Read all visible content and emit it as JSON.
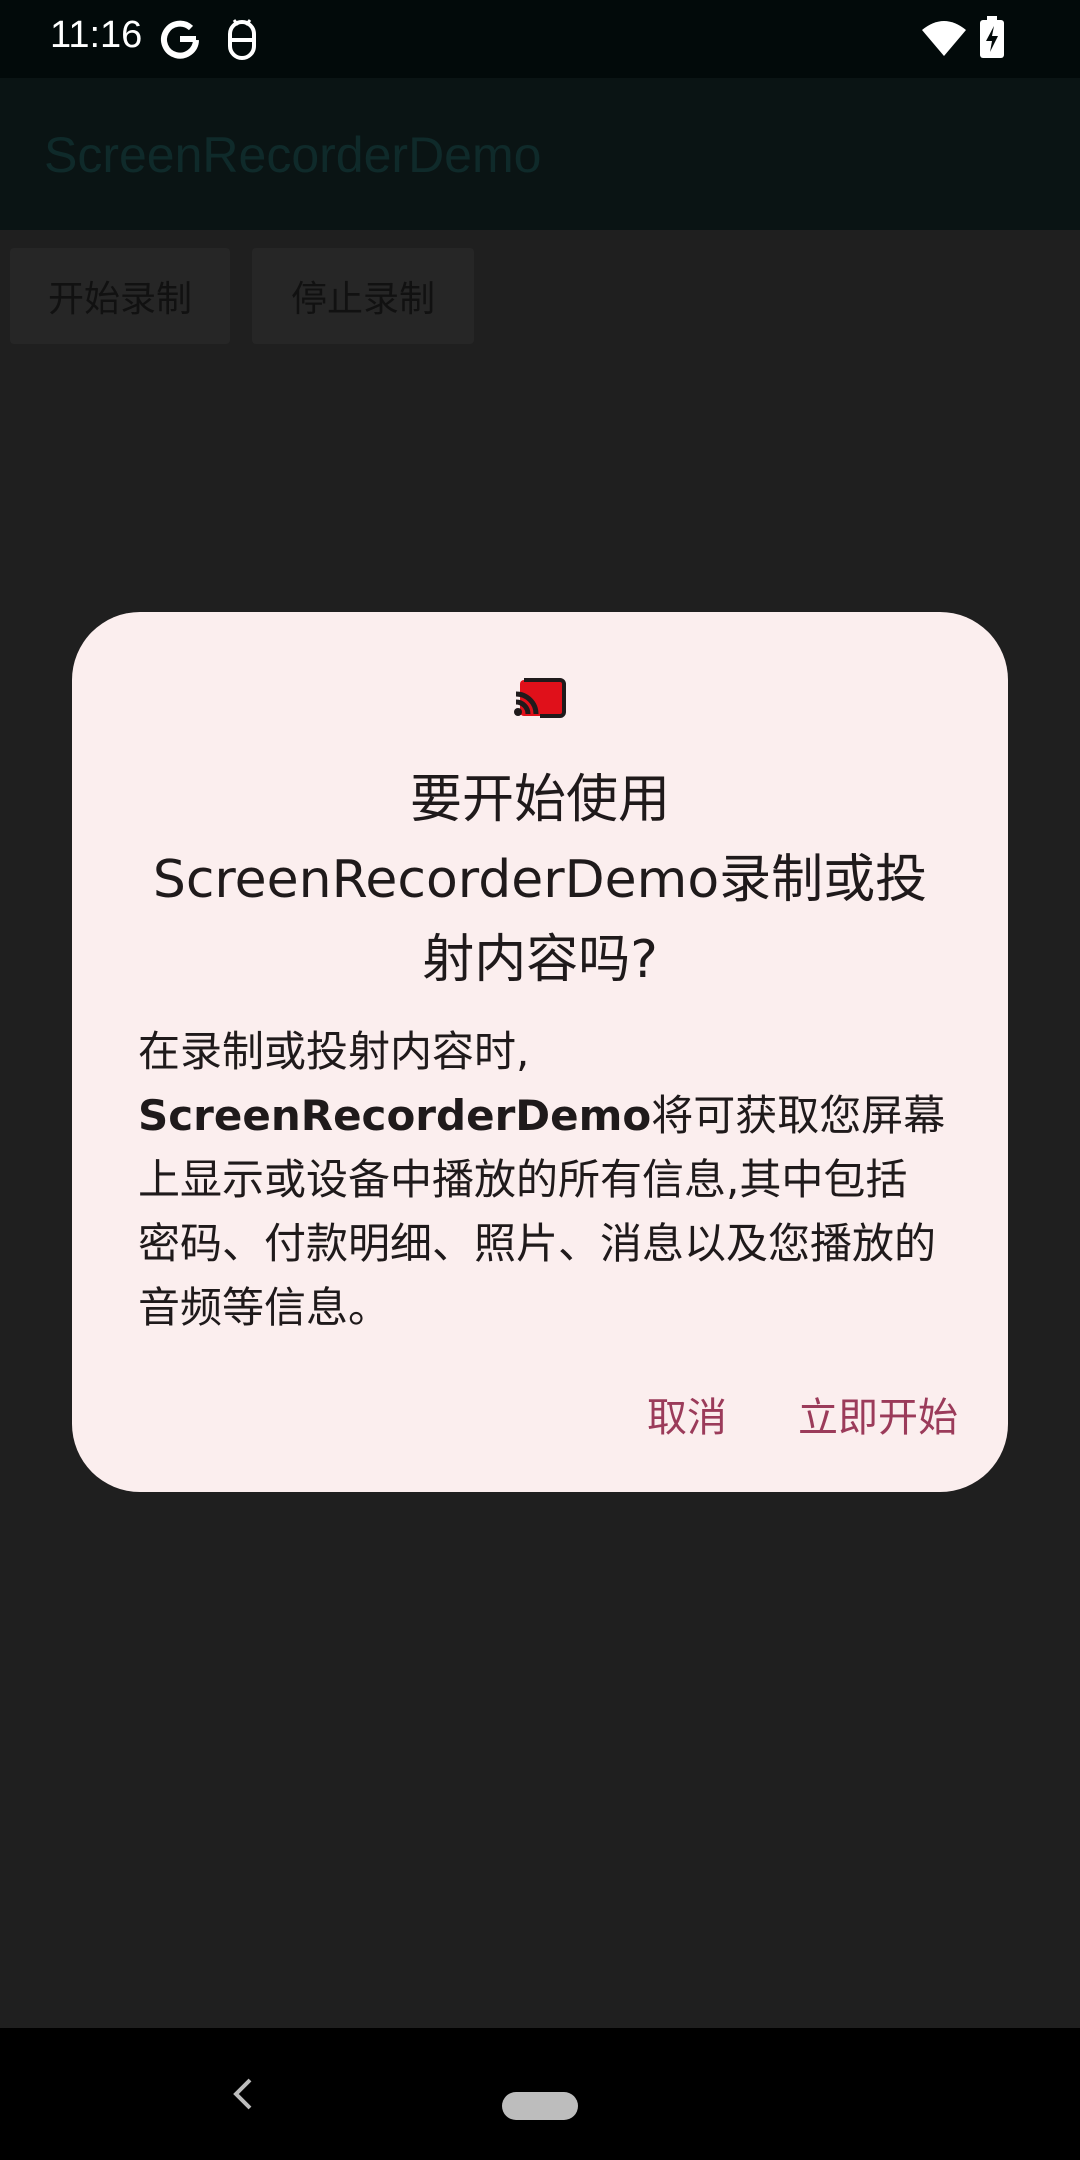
{
  "status_bar": {
    "time": "11:16",
    "icons": [
      "google-g-icon",
      "android-bug-icon",
      "wifi-icon",
      "battery-charging-icon"
    ]
  },
  "app_bar": {
    "title": "ScreenRecorderDemo"
  },
  "toolbar": {
    "start_label": "开始录制",
    "stop_label": "停止录制"
  },
  "dialog": {
    "icon": "cast-icon",
    "title": "要开始使用ScreenRecorderDemo录制或投射内容吗?",
    "body_prefix": "在录制或投射内容时,",
    "body_app": "ScreenRecorderDemo",
    "body_suffix": "将可获取您屏幕上显示或设备中播放的所有信息,其中包括密码、付款明细、照片、消息以及您播放的音频等信息。",
    "cancel_label": "取消",
    "confirm_label": "立即开始",
    "accent_color": "#9b3b5a",
    "background_color": "#fbeeee"
  },
  "nav_bar": {
    "back_icon": "back-chevron-icon",
    "home_icon": "home-pill-icon"
  }
}
